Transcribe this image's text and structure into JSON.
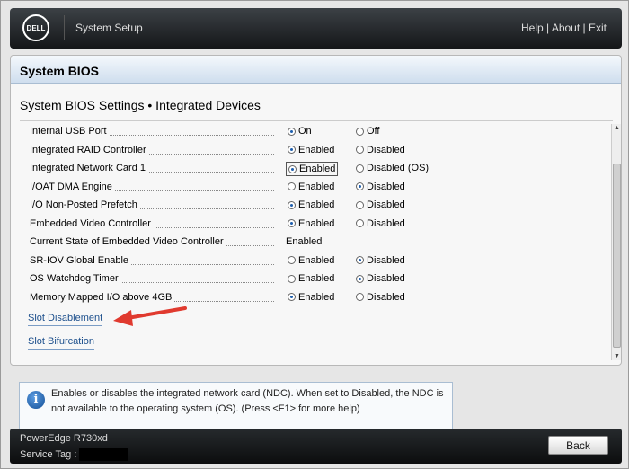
{
  "header": {
    "logo": "DELL",
    "title": "System Setup",
    "links": [
      "Help",
      "About",
      "Exit"
    ]
  },
  "panel": {
    "title": "System BIOS",
    "subtitle": "System BIOS Settings • Integrated Devices"
  },
  "settings": [
    {
      "label": "Internal USB Port",
      "options": [
        "On",
        "Off"
      ],
      "selected": 0
    },
    {
      "label": "Integrated RAID Controller",
      "options": [
        "Enabled",
        "Disabled"
      ],
      "selected": 0
    },
    {
      "label": "Integrated Network Card 1",
      "options": [
        "Enabled",
        "Disabled (OS)"
      ],
      "selected": 0,
      "focused": true
    },
    {
      "label": "I/OAT DMA Engine",
      "options": [
        "Enabled",
        "Disabled"
      ],
      "selected": 1
    },
    {
      "label": "I/O Non-Posted Prefetch",
      "options": [
        "Enabled",
        "Disabled"
      ],
      "selected": 0
    },
    {
      "label": "Embedded Video Controller",
      "options": [
        "Enabled",
        "Disabled"
      ],
      "selected": 0
    },
    {
      "label": "Current State of Embedded Video Controller",
      "value": "Enabled"
    },
    {
      "label": "SR-IOV Global Enable",
      "options": [
        "Enabled",
        "Disabled"
      ],
      "selected": 1
    },
    {
      "label": "OS Watchdog Timer",
      "options": [
        "Enabled",
        "Disabled"
      ],
      "selected": 1
    },
    {
      "label": "Memory Mapped I/O above 4GB",
      "options": [
        "Enabled",
        "Disabled"
      ],
      "selected": 0
    }
  ],
  "links": [
    "Slot Disablement",
    "Slot Bifurcation"
  ],
  "info": {
    "text": "Enables or disables the integrated network card (NDC).  When set to Disabled, the NDC is not available to the operating system (OS). (Press <F1> for more help)"
  },
  "footer": {
    "model": "PowerEdge R730xd",
    "service_tag_label": "Service Tag :",
    "back": "Back"
  },
  "colors": {
    "accent": "#1c4f8c",
    "arrow": "#e03a2f"
  }
}
